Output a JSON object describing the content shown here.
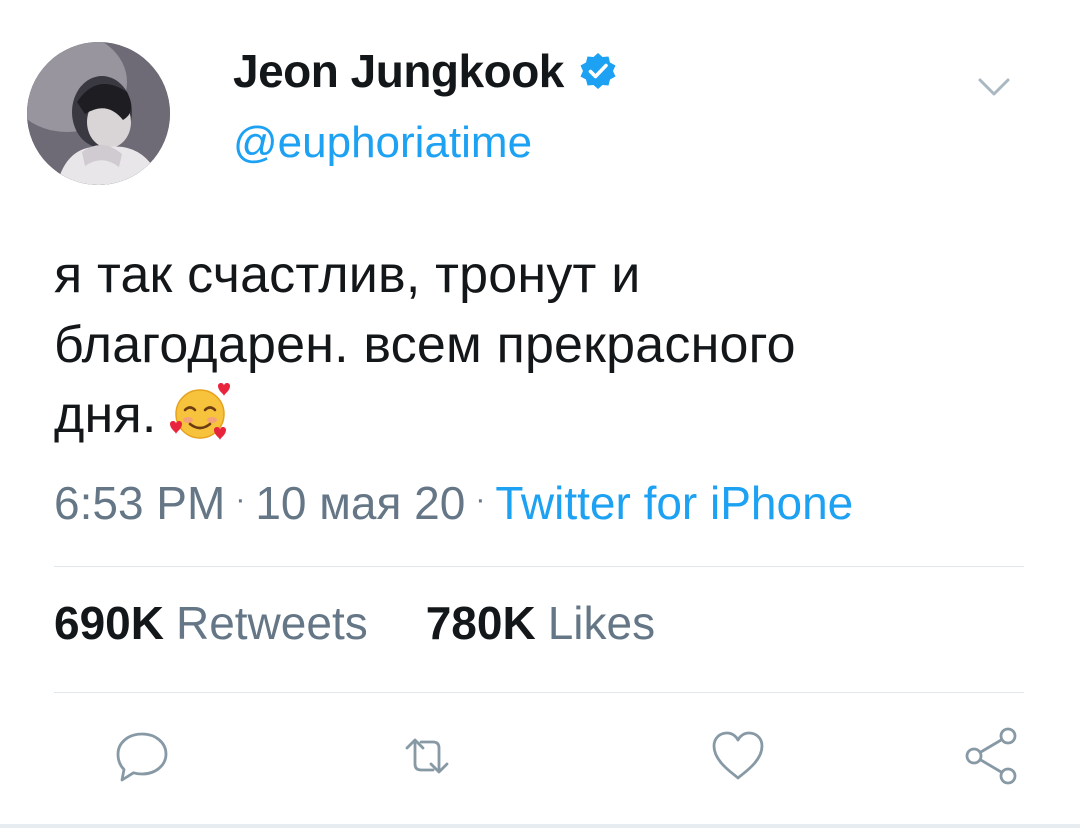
{
  "tweet": {
    "author": {
      "display_name": "Jeon Jungkook",
      "handle": "@euphoriatime",
      "verified": true,
      "avatar_icon": "profile-photo"
    },
    "text_line1": "я так счастлив, тронут и",
    "text_line2": "благодарен. всем прекрасного",
    "text_line3": "дня.",
    "emoji_icon": "smiling-face-with-hearts-emoji",
    "time": "6:53 PM",
    "date": "10 мая 20",
    "separator": "·",
    "source": "Twitter for iPhone",
    "stats": {
      "retweets_count": "690K",
      "retweets_label": "Retweets",
      "likes_count": "780K",
      "likes_label": "Likes"
    },
    "actions": [
      "reply-icon",
      "retweet-icon",
      "like-icon",
      "share-icon"
    ]
  },
  "colors": {
    "accent": "#1da1f2",
    "text": "#14171a",
    "secondary": "#657786",
    "divider": "#e1e8ed",
    "action_icon": "#8899a6"
  }
}
